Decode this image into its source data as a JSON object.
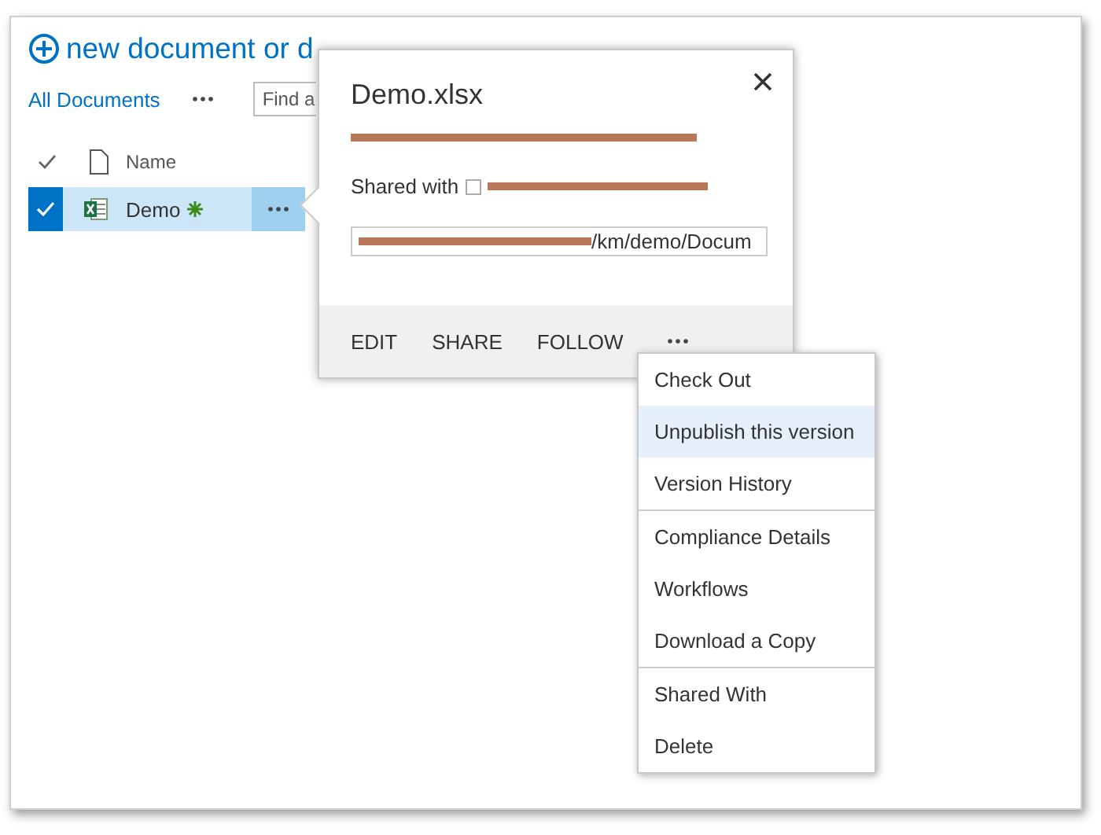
{
  "header": {
    "title": "new document or d"
  },
  "toolbar": {
    "view": "All Documents",
    "search": {
      "placeholder": "Find a"
    }
  },
  "columns": [
    {
      "label": "Name"
    }
  ],
  "rows": [
    {
      "name": "Demo",
      "selected": true,
      "new": true
    }
  ],
  "callout": {
    "title": "Demo.xlsx",
    "shared_label": "Shared with",
    "link_tail": "/km/demo/Docum",
    "actions": [
      "EDIT",
      "SHARE",
      "FOLLOW"
    ]
  },
  "menu": {
    "groups": [
      [
        {
          "label": "Check Out",
          "selected": false
        },
        {
          "label": "Unpublish this version",
          "selected": true
        },
        {
          "label": "Version History",
          "selected": false
        }
      ],
      [
        {
          "label": "Compliance Details",
          "selected": false
        },
        {
          "label": "Workflows",
          "selected": false
        },
        {
          "label": "Download a Copy",
          "selected": false
        }
      ],
      [
        {
          "label": "Shared With",
          "selected": false
        },
        {
          "label": "Delete",
          "selected": false
        }
      ]
    ]
  }
}
